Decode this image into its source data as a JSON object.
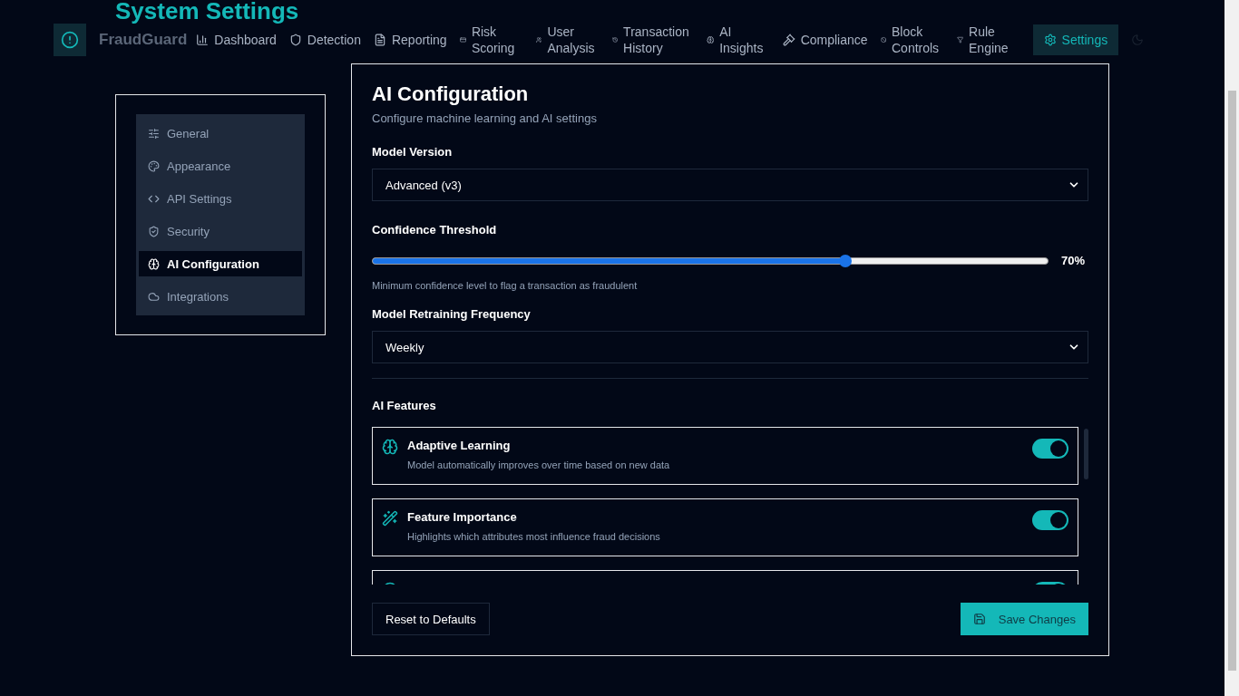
{
  "page_title": "System Settings",
  "brand": {
    "name": "FraudGuard"
  },
  "nav": [
    {
      "label": "Dashboard",
      "selected": false
    },
    {
      "label": "Detection",
      "selected": false
    },
    {
      "label": "Reporting",
      "selected": false
    },
    {
      "label": "Risk Scoring",
      "selected": false
    },
    {
      "label": "User Analysis",
      "selected": false
    },
    {
      "label": "Transaction History",
      "selected": false
    },
    {
      "label": "AI Insights",
      "selected": false
    },
    {
      "label": "Compliance",
      "selected": false
    },
    {
      "label": "Block Controls",
      "selected": false
    },
    {
      "label": "Rule Engine",
      "selected": false
    },
    {
      "label": "Settings",
      "selected": true
    }
  ],
  "sidebar": {
    "items": [
      {
        "label": "General",
        "selected": false
      },
      {
        "label": "Appearance",
        "selected": false
      },
      {
        "label": "API Settings",
        "selected": false
      },
      {
        "label": "Security",
        "selected": false
      },
      {
        "label": "AI Configuration",
        "selected": true
      },
      {
        "label": "Integrations",
        "selected": false
      }
    ]
  },
  "panel": {
    "title": "AI Configuration",
    "subtitle": "Configure machine learning and AI settings",
    "model_version": {
      "label": "Model Version",
      "value": "Advanced (v3)"
    },
    "confidence": {
      "label": "Confidence Threshold",
      "level": 0.7,
      "reading": "70%",
      "hint": "Minimum confidence level to flag a transaction as fraudulent"
    },
    "retraining": {
      "label": "Model Retraining Frequency",
      "value": "Weekly"
    },
    "features_title": "AI Features",
    "features": [
      {
        "title": "Adaptive Learning",
        "description": "Model automatically improves over time based on new data",
        "on": true
      },
      {
        "title": "Feature Importance",
        "description": "Highlights which attributes most influence fraud decisions",
        "on": true
      },
      {
        "on": true
      }
    ],
    "buttons": {
      "reset": "Reset to Defaults",
      "save": "Save Changes"
    }
  }
}
